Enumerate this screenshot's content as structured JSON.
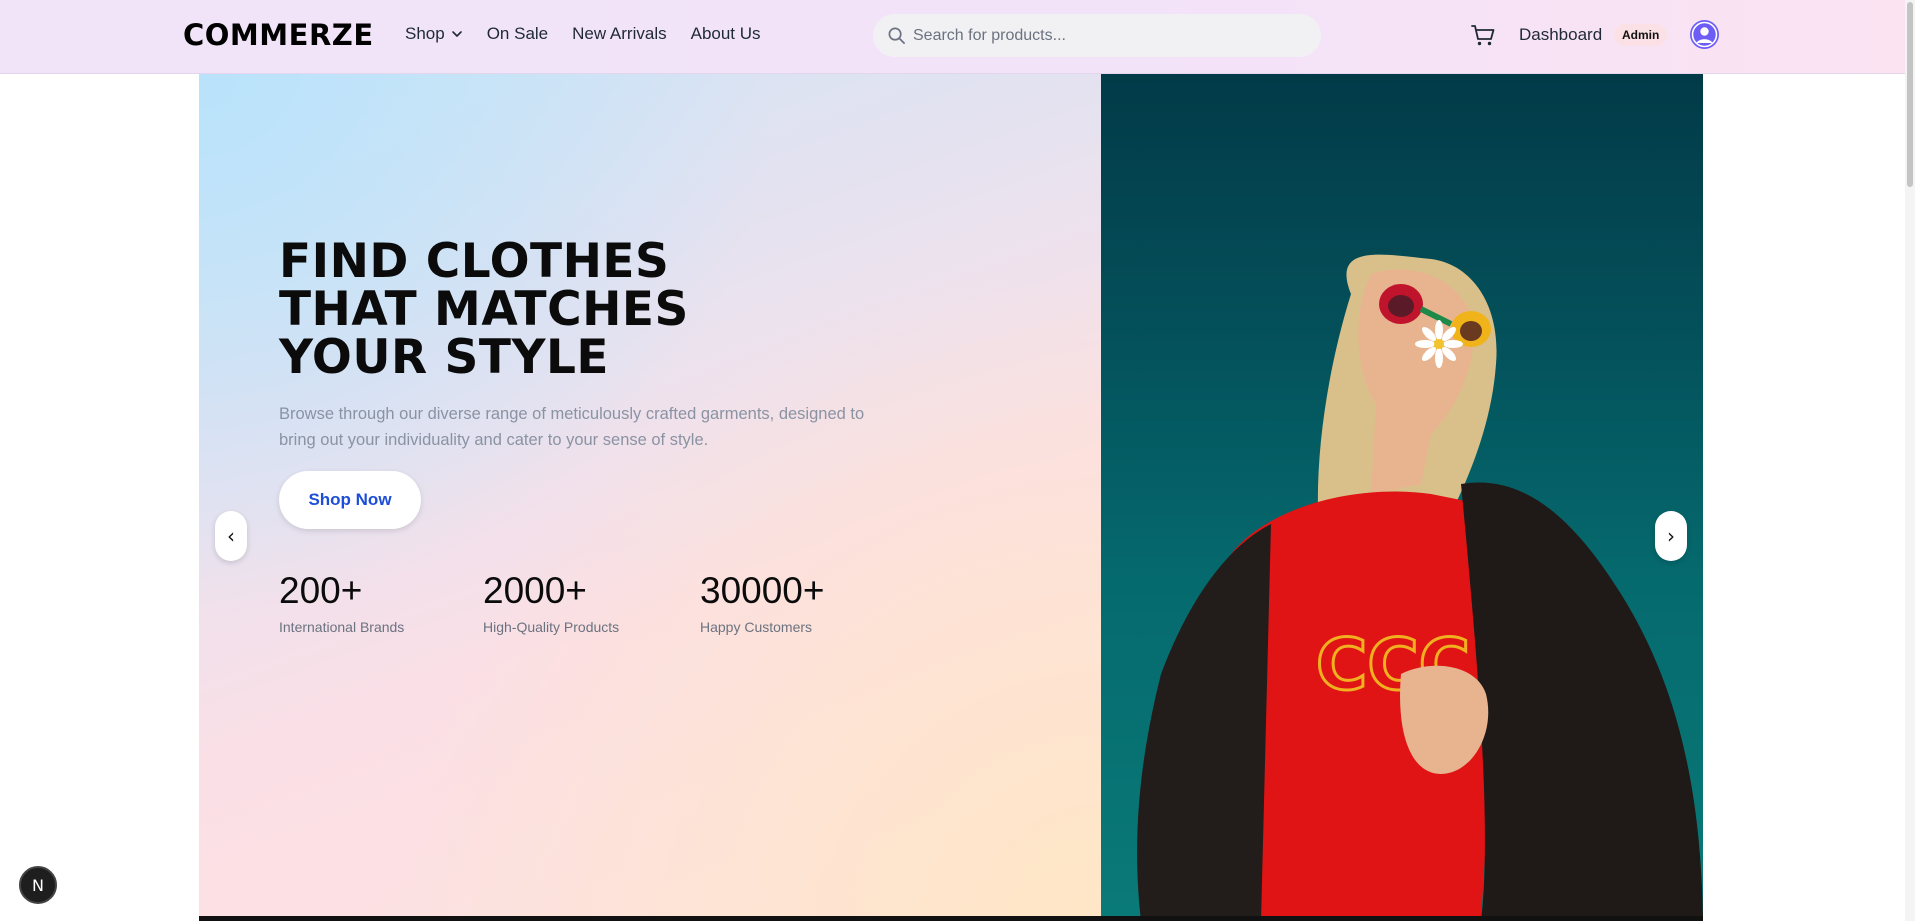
{
  "brand": {
    "logo": "COMMERZE"
  },
  "nav": {
    "links": [
      {
        "label": "Shop",
        "has_dropdown": true
      },
      {
        "label": "On Sale"
      },
      {
        "label": "New Arrivals"
      },
      {
        "label": "About Us"
      }
    ]
  },
  "search": {
    "placeholder": "Search for products..."
  },
  "header_actions": {
    "cart_icon": "cart-icon",
    "dashboard_label": "Dashboard",
    "role_badge": "Admin",
    "avatar_icon": "user-avatar-icon"
  },
  "hero": {
    "headline_lines": [
      "FIND CLOTHES",
      "THAT MATCHES",
      "YOUR STYLE"
    ],
    "subtitle": "Browse through our diverse range of meticulously crafted garments, designed to bring out your individuality and cater to your sense of style.",
    "cta_label": "Shop Now",
    "prev_arrow": "‹",
    "next_arrow": "›",
    "stats": [
      {
        "value": "200+",
        "label": "International Brands"
      },
      {
        "value": "2000+",
        "label": "High-Quality Products"
      },
      {
        "value": "30000+",
        "label": "Happy Customers"
      }
    ]
  },
  "dev_badge": {
    "letter": "N"
  },
  "colors": {
    "accent": "#1d4ed8",
    "avatar": "#6d5cf6",
    "hero_image_bg": "#04505a"
  }
}
